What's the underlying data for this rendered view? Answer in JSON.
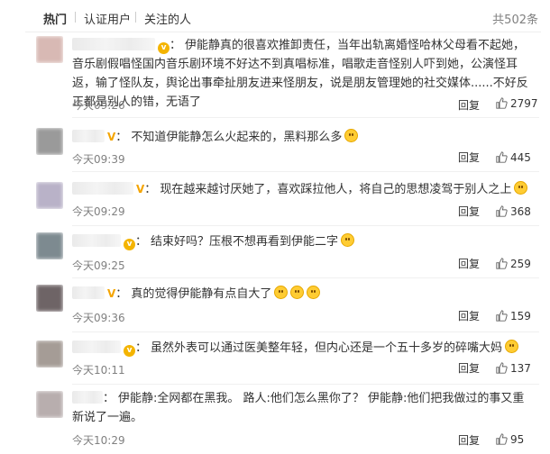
{
  "tabs": {
    "hot": "热门",
    "verified": "认证用户",
    "following": "关注的人",
    "total": "共502条"
  },
  "comments": [
    {
      "badge": "v",
      "text": "伊能静真的很喜欢推卸责任，当年出轨离婚怪哈林父母看不起她，音乐剧假唱怪国内音乐剧环境不好达不到真唱标准，唱歌走音怪别人吓到她，公演怪耳返，输了怪队友，舆论出事牵扯朋友进来怪朋友，说是朋友管理她的社交媒体......不好反正都是别人的错，无语了",
      "time": "今天09:26",
      "reply": "回复",
      "likes": "2797",
      "avatar_color": "#d8b9b4"
    },
    {
      "badge": "V",
      "text": "不知道伊能静怎么火起来的，黑料那么多",
      "time": "今天09:39",
      "reply": "回复",
      "likes": "445",
      "avatar_color": "#9a9a9a"
    },
    {
      "badge": "V",
      "text": "现在越来越讨厌她了，喜欢踩拉他人，将自己的思想凌驾于别人之上",
      "time": "今天09:29",
      "reply": "回复",
      "likes": "368",
      "avatar_color": "#b9b2c8"
    },
    {
      "badge": "v",
      "text": "结束好吗？压根不想再看到伊能二字",
      "time": "今天09:25",
      "reply": "回复",
      "likes": "259",
      "avatar_color": "#7d8a90"
    },
    {
      "badge": "V",
      "text": "真的觉得伊能静有点自大了",
      "time": "今天09:36",
      "reply": "回复",
      "likes": "159",
      "avatar_color": "#6e6466"
    },
    {
      "badge": "v",
      "text": "虽然外表可以通过医美整年轻，但内心还是一个五十多岁的碎嘴大妈",
      "time": "今天10:11",
      "reply": "回复",
      "likes": "137",
      "avatar_color": "#a59c96"
    },
    {
      "badge": "",
      "text": "伊能静:全网都在黑我。 路人:他们怎么黑你了？ 伊能静:他们把我做过的事又重新说了一遍。",
      "time": "今天10:29",
      "reply": "回复",
      "likes": "95",
      "avatar_color": "#b8aeae"
    }
  ]
}
